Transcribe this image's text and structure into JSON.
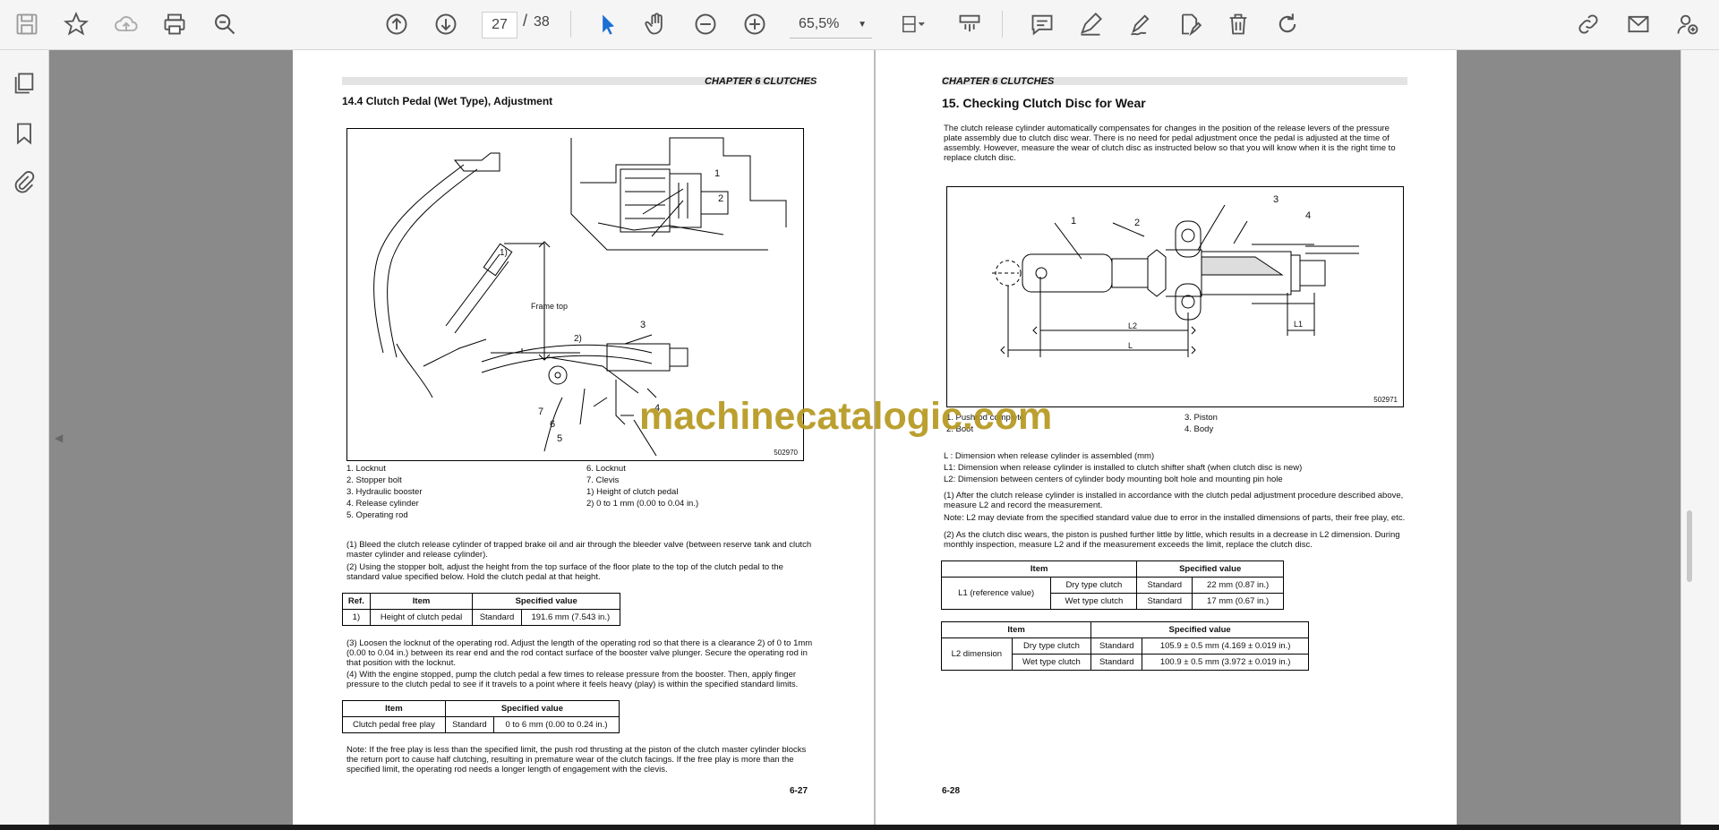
{
  "toolbar": {
    "icons": [
      "save-icon",
      "bookmark-star-icon",
      "cloud-upload-icon",
      "print-icon",
      "zoom-search-icon",
      "page-up-icon",
      "page-down-icon",
      "select-arrow-icon",
      "hand-icon",
      "zoom-out-icon",
      "zoom-in-icon",
      "fit-page-icon",
      "scan-icon",
      "comment-icon",
      "pen-icon",
      "sign-icon",
      "edit-pdf-icon",
      "delete-icon",
      "redo-icon",
      "share-link-icon",
      "mail-icon",
      "account-icon"
    ],
    "current_page": "27",
    "page_separator": "/",
    "total_pages": "38",
    "zoom": "65,5%"
  },
  "page_left": {
    "chapter": "CHAPTER 6 CLUTCHES",
    "heading": "14.4    Clutch Pedal (Wet Type), Adjustment",
    "figure_labels": {
      "l1": "1)",
      "l2": "2)",
      "frame": "Frame top",
      "n1": "1",
      "n2": "2",
      "n3": "3",
      "n4": "4",
      "n5": "5",
      "n6": "6",
      "n7": "7"
    },
    "figure_no": "502970",
    "legend_left": [
      "1.    Locknut",
      "2.    Stopper bolt",
      "3.    Hydraulic booster",
      "4.    Release cylinder",
      "5.    Operating rod"
    ],
    "legend_right": [
      "6.    Locknut",
      "7.    Clevis",
      "1)    Height of clutch pedal",
      "2)    0 to 1 mm (0.00 to 0.04 in.)"
    ],
    "step1": "(1)    Bleed the clutch release cylinder of trapped brake oil and air through the bleeder valve (between reserve tank and clutch master cylinder and release cylinder).",
    "step2": "(2)    Using the stopper bolt, adjust the height from the top surface of the floor plate to the top of the clutch pedal to the standard value specified below. Hold the clutch pedal at that height.",
    "table1": {
      "headers": [
        "Ref.",
        "Item",
        "Specified value"
      ],
      "row": [
        "1)",
        "Height of clutch pedal",
        "Standard",
        "191.6 mm (7.543 in.)"
      ]
    },
    "step3": "(3)    Loosen the locknut of the operating rod. Adjust the length of the operating rod so that there is a clearance 2) of 0 to 1mm (0.00 to 0.04 in.) between its rear end and the rod contact surface of the booster valve plunger. Secure the operating rod in that position with the locknut.",
    "step4": "(4)    With the engine stopped, pump the clutch pedal a few times to release pressure from the booster. Then, apply finger pressure to the clutch pedal to see if it travels to a point where it feels heavy (play) is within the specified standard limits.",
    "table2": {
      "headers": [
        "Item",
        "Specified value"
      ],
      "row": [
        "Clutch pedal free play",
        "Standard",
        "0 to 6 mm (0.00 to 0.24 in.)"
      ]
    },
    "note": "Note: If the free play is less than the specified limit, the push rod thrusting at the piston of the clutch master cylinder blocks the return port to cause half clutching, resulting in premature wear of the clutch facings. If the free play is more than the specified limit, the operating rod needs a longer length of engagement with the clevis.",
    "page_number": "6-27"
  },
  "page_right": {
    "chapter": "CHAPTER 6 CLUTCHES",
    "heading": "15.  Checking Clutch Disc for Wear",
    "intro": "The clutch release cylinder automatically compensates for changes in the position of the release levers of the pressure plate assembly due to clutch disc wear. There is no need for pedal adjustment once the pedal is adjusted at the time of assembly. However, measure the wear of clutch disc as instructed below so that you will know when it is the right time to replace clutch disc.",
    "figure_labels": {
      "n1": "1",
      "n2": "2",
      "n3": "3",
      "n4": "4",
      "L2": "L2",
      "L": "L",
      "L1": "L1"
    },
    "figure_no": "502971",
    "legend_left": [
      "1.    Pushrod complete",
      "2.    Boot"
    ],
    "legend_right": [
      "3.    Piston",
      "4.    Body"
    ],
    "dims": [
      "L : Dimension when release cylinder is assembled (mm)",
      "L1: Dimension when release cylinder is installed to clutch shifter shaft (when clutch disc is new)",
      "L2: Dimension between centers of cylinder body mounting bolt hole and mounting pin hole"
    ],
    "step1": "(1)    After the clutch release cylinder is installed in accordance with the clutch pedal adjustment procedure described above, measure L2 and record the measurement.",
    "note": "Note: L2 may deviate from the specified standard value due to error in the installed dimensions of parts, their free play, etc.",
    "step2": "(2)    As the clutch disc wears, the piston is pushed further little by little, which results in a decrease in L2 dimension. During monthly inspection, measure L2 and if the measurement exceeds the limit, replace the clutch disc.",
    "table1": {
      "headers": [
        "Item",
        "Specified value"
      ],
      "rowlabel": "L1 (reference value)",
      "rows": [
        [
          "Dry type clutch",
          "Standard",
          "22 mm (0.87 in.)"
        ],
        [
          "Wet type clutch",
          "Standard",
          "17 mm (0.67 in.)"
        ]
      ]
    },
    "table2": {
      "headers": [
        "Item",
        "Specified value"
      ],
      "rowlabel": "L2 dimension",
      "rows": [
        [
          "Dry type clutch",
          "Standard",
          "105.9 ± 0.5 mm (4.169 ± 0.019 in.)"
        ],
        [
          "Wet type clutch",
          "Standard",
          "100.9 ± 0.5 mm (3.972 ± 0.019 in.)"
        ]
      ]
    },
    "page_number": "6-28"
  },
  "watermark": "machinecatalogic.com",
  "sidebar": {
    "icons": [
      "pages-icon",
      "bookmarks-icon",
      "attachments-icon"
    ]
  }
}
